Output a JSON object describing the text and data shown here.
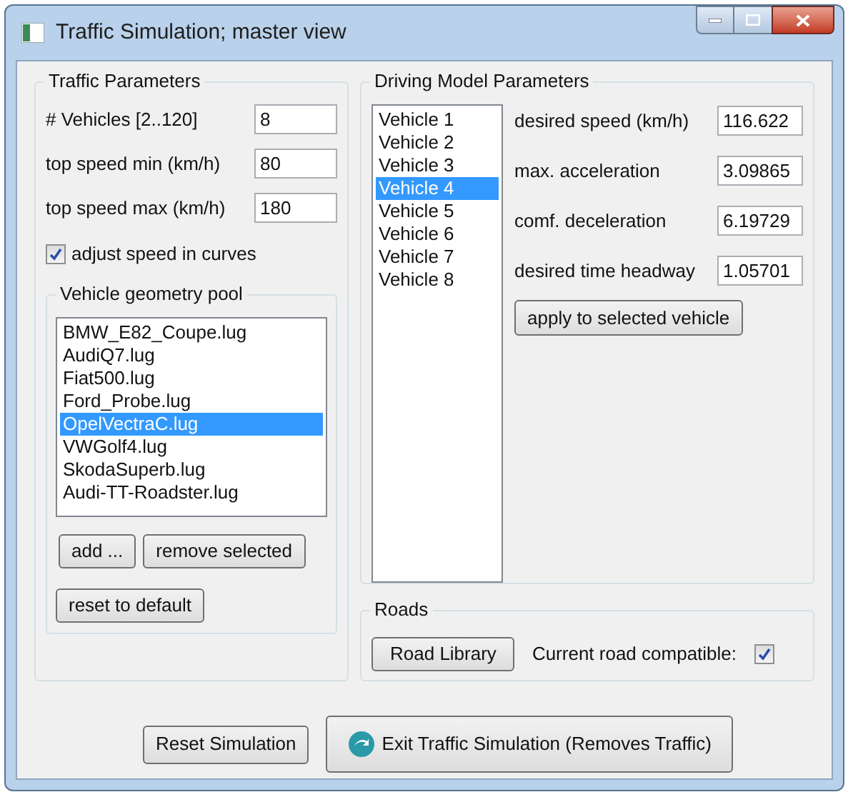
{
  "window": {
    "title": "Traffic Simulation; master view"
  },
  "traffic_parameters": {
    "title": "Traffic Parameters",
    "fields": [
      {
        "label": "# Vehicles [2..120]",
        "value": "8"
      },
      {
        "label": "top speed min (km/h)",
        "value": "80"
      },
      {
        "label": "top speed max (km/h)",
        "value": "180"
      }
    ],
    "adjust_speed": {
      "label": "adjust speed in curves",
      "checked": true
    },
    "geometry_pool": {
      "title": "Vehicle geometry pool",
      "items": [
        {
          "label": "BMW_E82_Coupe.lug",
          "selected": false
        },
        {
          "label": "AudiQ7.lug",
          "selected": false
        },
        {
          "label": "Fiat500.lug",
          "selected": false
        },
        {
          "label": "Ford_Probe.lug",
          "selected": false
        },
        {
          "label": "OpelVectraC.lug",
          "selected": true
        },
        {
          "label": "VWGolf4.lug",
          "selected": false
        },
        {
          "label": "SkodaSuperb.lug",
          "selected": false
        },
        {
          "label": "Audi-TT-Roadster.lug",
          "selected": false
        }
      ],
      "buttons": [
        "add ...",
        "remove selected",
        "reset to default"
      ]
    }
  },
  "driving_model": {
    "title": "Driving Model Parameters",
    "vehicles": [
      {
        "label": "Vehicle 1",
        "selected": false
      },
      {
        "label": "Vehicle 2",
        "selected": false
      },
      {
        "label": "Vehicle 3",
        "selected": false
      },
      {
        "label": "Vehicle 4",
        "selected": true
      },
      {
        "label": "Vehicle 5",
        "selected": false
      },
      {
        "label": "Vehicle 6",
        "selected": false
      },
      {
        "label": "Vehicle 7",
        "selected": false
      },
      {
        "label": "Vehicle 8",
        "selected": false
      }
    ],
    "fields": [
      {
        "label": "desired speed (km/h)",
        "value": "116.622"
      },
      {
        "label": "max. acceleration",
        "value": "3.09865"
      },
      {
        "label": "comf. deceleration",
        "value": "6.19729"
      },
      {
        "label": "desired time headway",
        "value": "1.05701"
      }
    ],
    "apply_button": "apply to selected vehicle"
  },
  "roads": {
    "title": "Roads",
    "button": "Road Library",
    "compatible": {
      "label": "Current road compatible:",
      "checked": true
    }
  },
  "buttons": {
    "reset": "Reset Simulation",
    "exit": "Exit Traffic Simulation (Removes Traffic)"
  }
}
